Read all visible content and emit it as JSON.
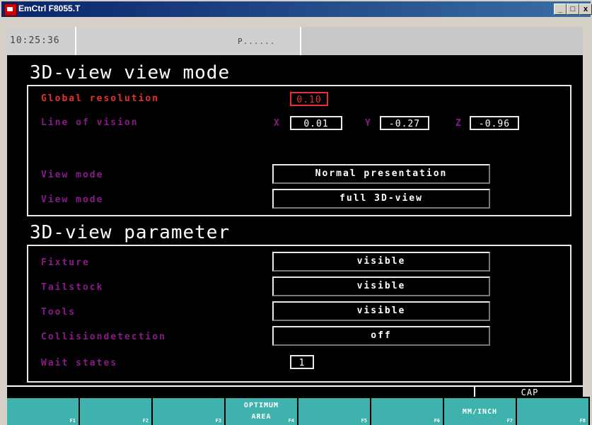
{
  "window": {
    "title": "EmCtrl F8055.T",
    "controls": [
      "_",
      "□",
      "x"
    ]
  },
  "status": {
    "time": "10:25:36",
    "mode": "P......"
  },
  "view_mode": {
    "title": "3D-view view mode",
    "global_resolution_label": "Global resolution",
    "global_resolution_value": "0.10",
    "line_of_vision_label": "Line of vision",
    "x_label": "X",
    "x_value": "0.01",
    "y_label": "Y",
    "y_value": "-0.27",
    "z_label": "Z",
    "z_value": "-0.96",
    "view_mode_1_label": "View mode",
    "view_mode_1_value": "Normal presentation",
    "view_mode_2_label": "View mode",
    "view_mode_2_value": "full 3D-view"
  },
  "parameter": {
    "title": "3D-view parameter",
    "fixture_label": "Fixture",
    "fixture_value": "visible",
    "tailstock_label": "Tailstock",
    "tailstock_value": "visible",
    "tools_label": "Tools",
    "tools_value": "visible",
    "collision_label": "Collisiondetection",
    "collision_value": "off",
    "wait_label": "Wait states",
    "wait_value": "1"
  },
  "bottom": {
    "cap": "CAP"
  },
  "fkeys": [
    {
      "label": "",
      "num": "F1"
    },
    {
      "label": "",
      "num": "F2"
    },
    {
      "label": "",
      "num": "F3"
    },
    {
      "label": "OPTIMUM\nAREA",
      "num": "F4"
    },
    {
      "label": "",
      "num": "F5"
    },
    {
      "label": "",
      "num": "F6"
    },
    {
      "label": "MM/INCH",
      "num": "F7"
    },
    {
      "label": "",
      "num": "F8"
    }
  ],
  "colors": {
    "label_purple": "#8a1a8a",
    "label_red": "#e83030",
    "fkey_teal": "#3fb2ad"
  }
}
